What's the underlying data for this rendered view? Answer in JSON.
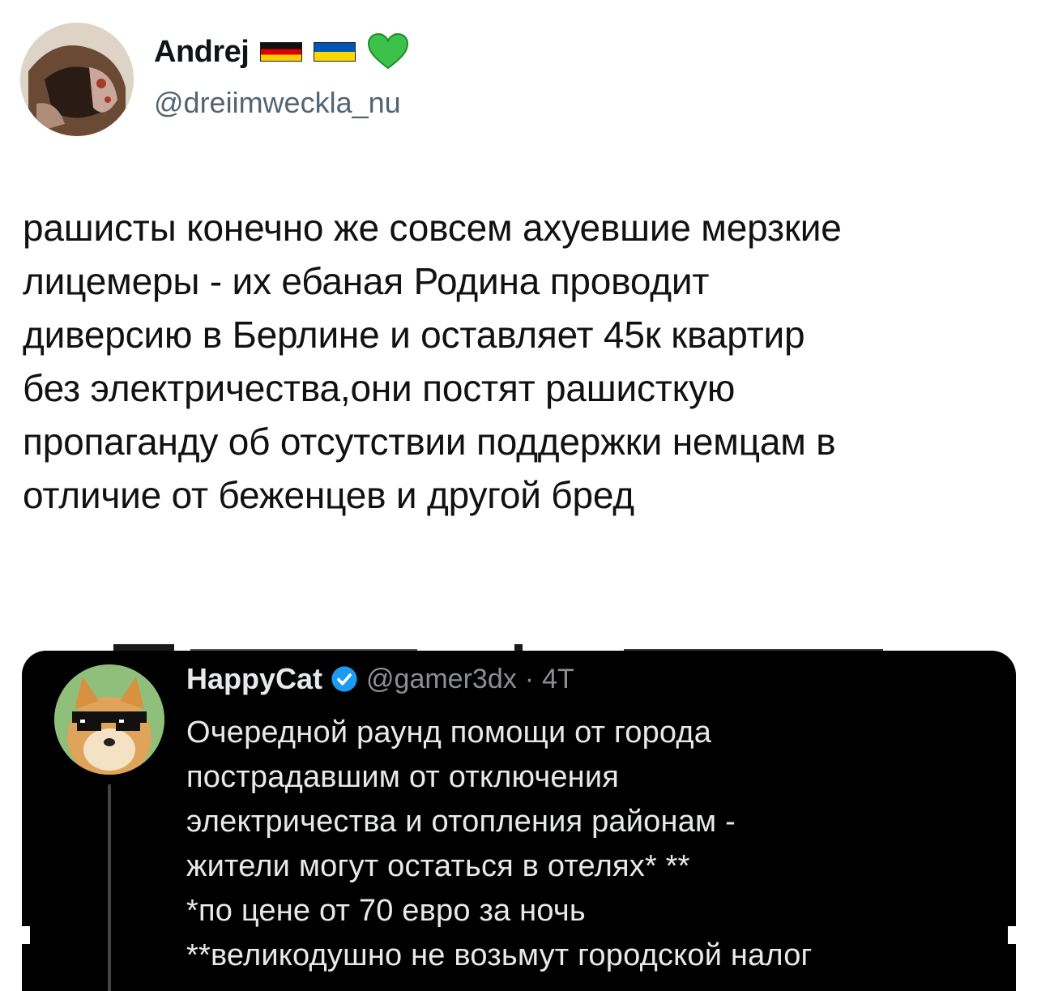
{
  "main_tweet": {
    "author_name": "Andrej",
    "author_handle": "@dreiimweckla_nu",
    "name_emojis": [
      "germany-flag",
      "ukraine-flag",
      "green-heart"
    ],
    "text_lines": [
      "рашисты конечно же совсем ахуевшие мерзкие",
      "лицемеры - их ебаная Родина проводит",
      "диверсию в Берлине и оставляет 45к квартир",
      "без электричества,они постят рашисткую",
      "пропаганду об отсутствии поддержки немцам в",
      "отличие от беженцев и другой бред"
    ]
  },
  "embedded_tweet": {
    "author_name": "HappyCat",
    "author_handle": "@gamer3dx",
    "separator": "·",
    "time": "4Т",
    "text_lines": [
      "Очередной раунд помощи от города",
      "пострадавшим от отключения",
      "электричества и отопления районам -",
      "жители могут остаться в отелях* **",
      "*по цене от 70 евро за ночь",
      "**великодушно не возьмут городской налог"
    ]
  },
  "colors": {
    "text_primary": "#0f1419",
    "text_secondary": "#536471",
    "embed_background": "#000000",
    "embed_text": "#e7e9ea",
    "embed_secondary": "#8b8f93",
    "verified_blue": "#1d9bf0",
    "heart_green": "#3cc24a"
  }
}
